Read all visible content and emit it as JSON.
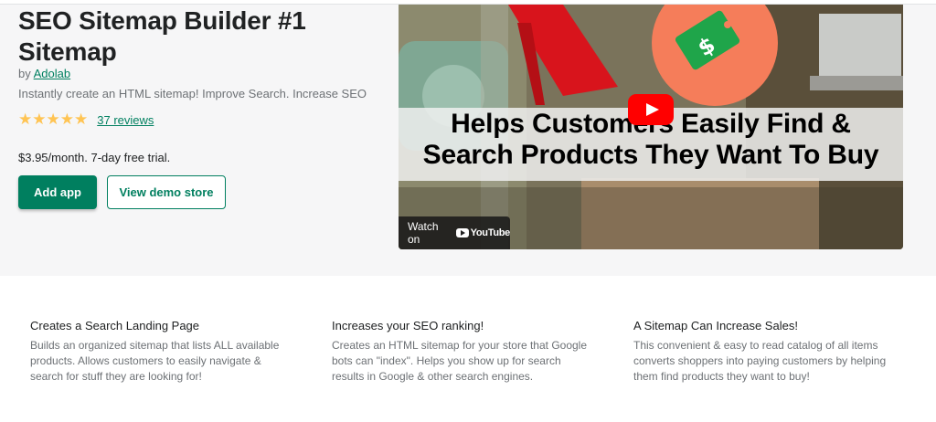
{
  "app": {
    "title": "SEO Sitemap Builder #1 Sitemap",
    "by_prefix": "by",
    "developer": "Adolab",
    "tagline": "Instantly create an HTML sitemap! Improve Search. Increase SEO",
    "rating_stars": 5,
    "reviews_label": "37 reviews",
    "pricing": "$3.95/month. 7-day free trial."
  },
  "buttons": {
    "add_app": "Add app",
    "view_demo": "View demo store"
  },
  "video": {
    "caption_line1": "Helps Customers Easily Find &",
    "caption_line2": "Search Products They Want To Buy",
    "watch_on": "Watch on",
    "youtube": "YouTube",
    "price_tag_glyph": "$"
  },
  "features": [
    {
      "title": "Creates a Search Landing Page",
      "description": "Builds an organized sitemap that lists ALL available products. Allows customers to easily navigate & search for stuff they are looking for!"
    },
    {
      "title": "Increases your SEO ranking!",
      "description": "Creates an HTML sitemap for your store that Google bots can \"index\". Helps you show up for search results in Google & other search engines."
    },
    {
      "title": "A Sitemap Can Increase Sales!",
      "description": "This convenient & easy to read catalog of all items converts shoppers into paying customers by helping them find products they want to buy!"
    }
  ],
  "colors": {
    "accent": "#007f5f",
    "star": "#ffc453",
    "youtube_red": "#ff0000"
  }
}
